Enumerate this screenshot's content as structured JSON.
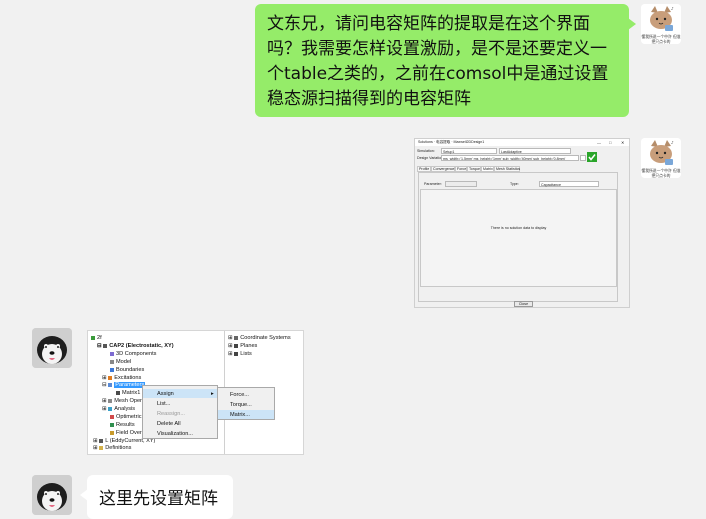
{
  "messages": {
    "outgoing_text": "文东兄，请问电容矩阵的提取是在这个界面吗？我需要怎样设置激励，是不是还要定义一个table之类的，之前在comsol中是通过设置稳态源扫描得到的电容矩阵",
    "incoming_text": "这里先设置矩阵"
  },
  "avatar_caption": "懂我所说一个中许 但准把只点卡的",
  "dialog": {
    "title": "Solutions · 电容提取 · Maxwell2DDesign1",
    "window_buttons": [
      "—",
      "□",
      "✕"
    ],
    "simulation_label": "Simulation:",
    "simulation_value": "Setup1",
    "simulation_value2": "LastAdaptive",
    "design_variation_label": "Design Variation:",
    "design_variation_value": "ms_width='1.5mm' ms_height='1mm' sub_width='40mm' sub_height='0.8mm'",
    "tabs": [
      "Profile",
      "Convergence",
      "Force",
      "Torque",
      "Matrix",
      "Mesh Statistics"
    ],
    "active_tab": "Matrix",
    "parameter_label": "Parameter:",
    "pass_label": "Pass:",
    "type_label": "Type:",
    "type_value": "Capacitance",
    "cap_units_label": "Capacitance Units:",
    "subtabs": [
      "Main",
      "Reduced"
    ],
    "empty_message": "There is no solution data to display",
    "close_button": "Close"
  },
  "tree": {
    "root": "2f",
    "design": "CAP2 (Electrostatic, XY)",
    "items": [
      "3D Components",
      "Model",
      "Boundaries",
      "Excitations",
      "Parameters",
      "Matrix1",
      "Mesh Oper",
      "Analysis",
      "Optimetric",
      "Results",
      "Field Overl"
    ],
    "bottom_items": [
      "L (EddyCurrent, XY)",
      "Definitions"
    ],
    "right_items": [
      "Coordinate Systems",
      "Planes",
      "Lists"
    ]
  },
  "context_menu": {
    "items": [
      "Assign",
      "List...",
      "Reassign...",
      "Delete All",
      "Visualization..."
    ],
    "highlighted": "Assign"
  },
  "submenu": {
    "items": [
      "Force...",
      "Torque...",
      "Matrix..."
    ],
    "highlighted": "Matrix..."
  },
  "colors": {
    "outgoing_bubble": "#95ec69",
    "incoming_bubble": "#ffffff",
    "background": "#f1f1f1",
    "selection": "#3399ff",
    "menu_highlight": "#cce4f7"
  }
}
